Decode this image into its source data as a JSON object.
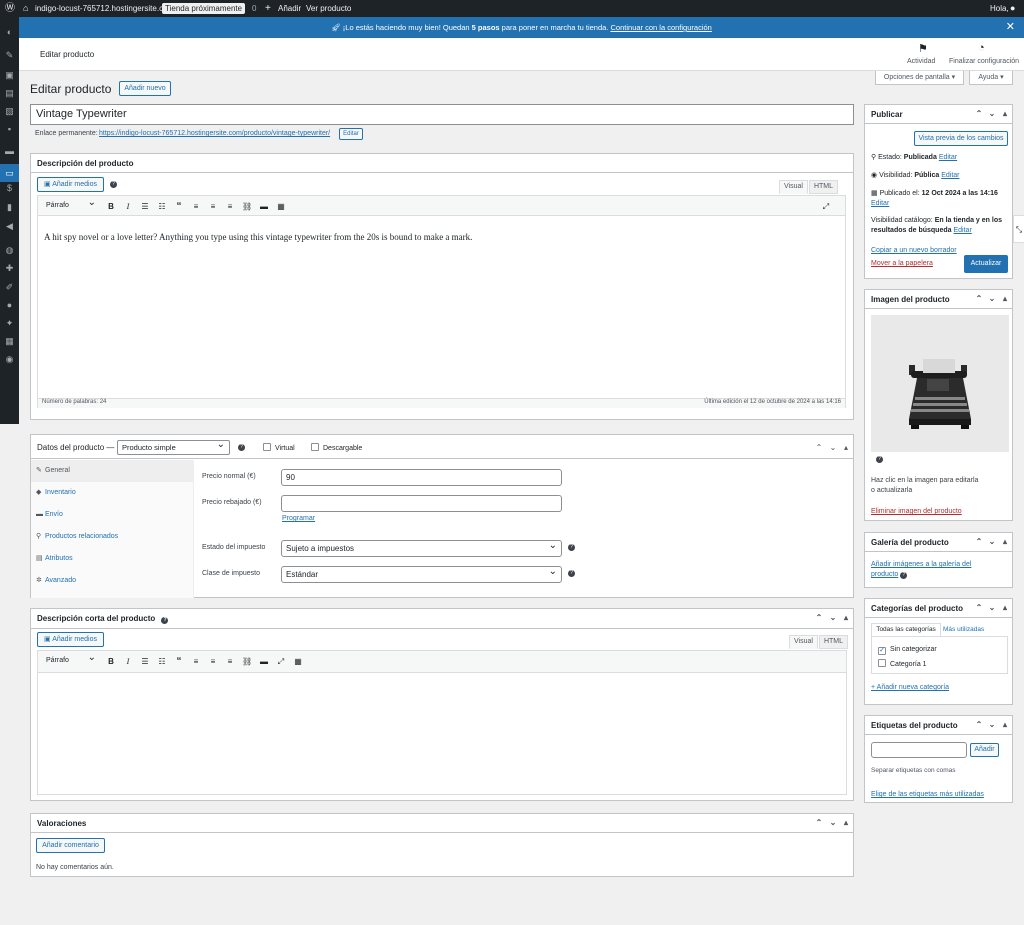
{
  "adminbar": {
    "site": "indigo-locust-765712.hostingersite.com",
    "badge": "Tienda próximamente",
    "comments": "0",
    "add": "Añadir",
    "view": "Ver producto",
    "greeting": "Hola,"
  },
  "notice": {
    "text": "¡Lo estás haciendo muy bien! Quedan",
    "count": "5 pasos",
    "text2": "para poner en marcha tu tienda.",
    "link": "Continuar con la configuración"
  },
  "topstrip": {
    "title": "Editar producto",
    "activity": "Actividad",
    "finish": "Finalizar configuración"
  },
  "screen": {
    "options": "Opciones de pantalla",
    "help": "Ayuda"
  },
  "page": {
    "heading": "Editar producto",
    "add_new": "Añadir nuevo",
    "product_title": "Vintage Typewriter",
    "permalink_label": "Enlace permanente:",
    "permalink": "https://indigo-locust-765712.hostingersite.com/producto/vintage-typewriter/",
    "edit": "Editar"
  },
  "description": {
    "title": "Descripción del producto",
    "add_media": "Añadir medios",
    "tab_visual": "Visual",
    "tab_html": "HTML",
    "format": "Párrafo",
    "content": "A hit spy novel or a love letter? Anything you type using this vintage typewriter from the 20s is bound to make a mark.",
    "word_count": "Número de palabras: 24",
    "last_edit": "Última edición el 12 de octubre de 2024 a las 14:16"
  },
  "product_data": {
    "title": "Datos del producto —",
    "type": "Producto simple",
    "virtual": "Virtual",
    "downloadable": "Descargable",
    "tabs": [
      {
        "label": "General",
        "icon": "wrench-icon",
        "glyph": "✎"
      },
      {
        "label": "Inventario",
        "icon": "tag-icon",
        "glyph": "◆"
      },
      {
        "label": "Envío",
        "icon": "truck-icon",
        "glyph": "▬"
      },
      {
        "label": "Productos relacionados",
        "icon": "link-icon",
        "glyph": "⚲"
      },
      {
        "label": "Atributos",
        "icon": "list-icon",
        "glyph": "▤"
      },
      {
        "label": "Avanzado",
        "icon": "gear-icon",
        "glyph": "✲"
      }
    ],
    "regular_price_label": "Precio normal (€)",
    "regular_price": "90",
    "sale_price_label": "Precio rebajado (€)",
    "sale_price": "",
    "schedule": "Programar",
    "tax_status_label": "Estado del impuesto",
    "tax_status": "Sujeto a impuestos",
    "tax_class_label": "Clase de impuesto",
    "tax_class": "Estándar"
  },
  "short_description": {
    "title": "Descripción corta del producto",
    "add_media": "Añadir medios",
    "tab_visual": "Visual",
    "tab_html": "HTML",
    "format": "Párrafo"
  },
  "reviews": {
    "title": "Valoraciones",
    "add_comment": "Añadir comentario",
    "empty": "No hay comentarios aún."
  },
  "publish": {
    "title": "Publicar",
    "preview": "Vista previa de los cambios",
    "status_label": "Estado:",
    "status": "Publicada",
    "visibility_label": "Visibilidad:",
    "visibility": "Pública",
    "published_label": "Publicado el:",
    "published": "12 Oct 2024 a las 14:16",
    "edit": "Editar",
    "catalog_label": "Visibilidad catálogo:",
    "catalog_line1": "En la tienda y en los",
    "catalog_line2": "resultados de búsqueda",
    "copy_draft": "Copiar a un nuevo borrador",
    "trash": "Mover a la papelera",
    "update": "Actualizar"
  },
  "product_image": {
    "title": "Imagen del producto",
    "hint1": "Haz clic en la imagen para editarla",
    "hint2": "o actualizarla",
    "remove": "Eliminar imagen del producto"
  },
  "gallery": {
    "title": "Galería del producto",
    "add1": "Añadir imágenes a la galería del",
    "add2": "producto"
  },
  "categories": {
    "title": "Categorías del producto",
    "tab_all": "Todas las categorías",
    "tab_used": "Más utilizadas",
    "items": [
      {
        "label": "Sin categorizar",
        "checked": true
      },
      {
        "label": "Categoría 1",
        "checked": false
      }
    ],
    "add_new": "+ Añadir nueva categoría"
  },
  "tags": {
    "title": "Etiquetas del producto",
    "add": "Añadir",
    "separator": "Separar etiquetas con comas",
    "choose": "Elige de las etiquetas más utilizadas"
  }
}
